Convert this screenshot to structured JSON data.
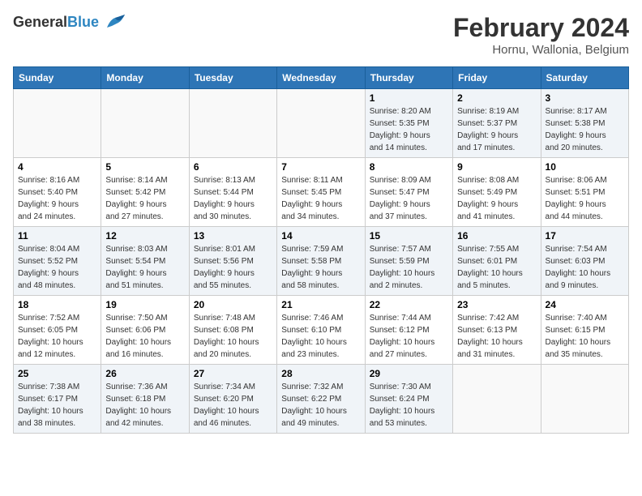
{
  "header": {
    "logo_general": "General",
    "logo_blue": "Blue",
    "title": "February 2024",
    "location": "Hornu, Wallonia, Belgium"
  },
  "calendar": {
    "headers": [
      "Sunday",
      "Monday",
      "Tuesday",
      "Wednesday",
      "Thursday",
      "Friday",
      "Saturday"
    ],
    "weeks": [
      [
        {
          "day": "",
          "info": ""
        },
        {
          "day": "",
          "info": ""
        },
        {
          "day": "",
          "info": ""
        },
        {
          "day": "",
          "info": ""
        },
        {
          "day": "1",
          "info": "Sunrise: 8:20 AM\nSunset: 5:35 PM\nDaylight: 9 hours\nand 14 minutes."
        },
        {
          "day": "2",
          "info": "Sunrise: 8:19 AM\nSunset: 5:37 PM\nDaylight: 9 hours\nand 17 minutes."
        },
        {
          "day": "3",
          "info": "Sunrise: 8:17 AM\nSunset: 5:38 PM\nDaylight: 9 hours\nand 20 minutes."
        }
      ],
      [
        {
          "day": "4",
          "info": "Sunrise: 8:16 AM\nSunset: 5:40 PM\nDaylight: 9 hours\nand 24 minutes."
        },
        {
          "day": "5",
          "info": "Sunrise: 8:14 AM\nSunset: 5:42 PM\nDaylight: 9 hours\nand 27 minutes."
        },
        {
          "day": "6",
          "info": "Sunrise: 8:13 AM\nSunset: 5:44 PM\nDaylight: 9 hours\nand 30 minutes."
        },
        {
          "day": "7",
          "info": "Sunrise: 8:11 AM\nSunset: 5:45 PM\nDaylight: 9 hours\nand 34 minutes."
        },
        {
          "day": "8",
          "info": "Sunrise: 8:09 AM\nSunset: 5:47 PM\nDaylight: 9 hours\nand 37 minutes."
        },
        {
          "day": "9",
          "info": "Sunrise: 8:08 AM\nSunset: 5:49 PM\nDaylight: 9 hours\nand 41 minutes."
        },
        {
          "day": "10",
          "info": "Sunrise: 8:06 AM\nSunset: 5:51 PM\nDaylight: 9 hours\nand 44 minutes."
        }
      ],
      [
        {
          "day": "11",
          "info": "Sunrise: 8:04 AM\nSunset: 5:52 PM\nDaylight: 9 hours\nand 48 minutes."
        },
        {
          "day": "12",
          "info": "Sunrise: 8:03 AM\nSunset: 5:54 PM\nDaylight: 9 hours\nand 51 minutes."
        },
        {
          "day": "13",
          "info": "Sunrise: 8:01 AM\nSunset: 5:56 PM\nDaylight: 9 hours\nand 55 minutes."
        },
        {
          "day": "14",
          "info": "Sunrise: 7:59 AM\nSunset: 5:58 PM\nDaylight: 9 hours\nand 58 minutes."
        },
        {
          "day": "15",
          "info": "Sunrise: 7:57 AM\nSunset: 5:59 PM\nDaylight: 10 hours\nand 2 minutes."
        },
        {
          "day": "16",
          "info": "Sunrise: 7:55 AM\nSunset: 6:01 PM\nDaylight: 10 hours\nand 5 minutes."
        },
        {
          "day": "17",
          "info": "Sunrise: 7:54 AM\nSunset: 6:03 PM\nDaylight: 10 hours\nand 9 minutes."
        }
      ],
      [
        {
          "day": "18",
          "info": "Sunrise: 7:52 AM\nSunset: 6:05 PM\nDaylight: 10 hours\nand 12 minutes."
        },
        {
          "day": "19",
          "info": "Sunrise: 7:50 AM\nSunset: 6:06 PM\nDaylight: 10 hours\nand 16 minutes."
        },
        {
          "day": "20",
          "info": "Sunrise: 7:48 AM\nSunset: 6:08 PM\nDaylight: 10 hours\nand 20 minutes."
        },
        {
          "day": "21",
          "info": "Sunrise: 7:46 AM\nSunset: 6:10 PM\nDaylight: 10 hours\nand 23 minutes."
        },
        {
          "day": "22",
          "info": "Sunrise: 7:44 AM\nSunset: 6:12 PM\nDaylight: 10 hours\nand 27 minutes."
        },
        {
          "day": "23",
          "info": "Sunrise: 7:42 AM\nSunset: 6:13 PM\nDaylight: 10 hours\nand 31 minutes."
        },
        {
          "day": "24",
          "info": "Sunrise: 7:40 AM\nSunset: 6:15 PM\nDaylight: 10 hours\nand 35 minutes."
        }
      ],
      [
        {
          "day": "25",
          "info": "Sunrise: 7:38 AM\nSunset: 6:17 PM\nDaylight: 10 hours\nand 38 minutes."
        },
        {
          "day": "26",
          "info": "Sunrise: 7:36 AM\nSunset: 6:18 PM\nDaylight: 10 hours\nand 42 minutes."
        },
        {
          "day": "27",
          "info": "Sunrise: 7:34 AM\nSunset: 6:20 PM\nDaylight: 10 hours\nand 46 minutes."
        },
        {
          "day": "28",
          "info": "Sunrise: 7:32 AM\nSunset: 6:22 PM\nDaylight: 10 hours\nand 49 minutes."
        },
        {
          "day": "29",
          "info": "Sunrise: 7:30 AM\nSunset: 6:24 PM\nDaylight: 10 hours\nand 53 minutes."
        },
        {
          "day": "",
          "info": ""
        },
        {
          "day": "",
          "info": ""
        }
      ]
    ]
  }
}
